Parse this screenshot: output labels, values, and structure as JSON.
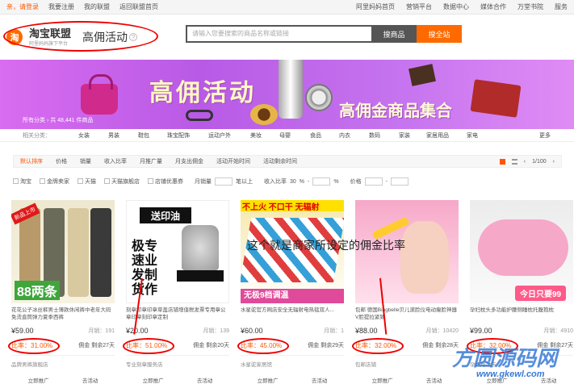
{
  "topnav": {
    "greeting": "亲，请登录",
    "register": "我要注册",
    "my_alliance": "我的联盟",
    "back_home": "返回联盟首页",
    "right_links": [
      "阿里妈妈首页",
      "营销平台",
      "数据中心",
      "媒体合作",
      "万堂书院",
      "服务"
    ]
  },
  "header": {
    "logo_title": "淘宝联盟",
    "logo_sub": "阿里妈妈旗下平台",
    "page_name": "高佣活动",
    "search_placeholder": "请输入您要搜索的商品名称或链接",
    "search_btn_product": "搜商品",
    "search_btn_all": "搜全站"
  },
  "banner": {
    "title": "高佣活动",
    "subtitle": "高佣金商品集合",
    "breadcrumb": "所有分类 › 共 48,441 件商品"
  },
  "categories": {
    "label": "相关分类：",
    "items": [
      "女装",
      "男装",
      "鞋包",
      "珠宝配饰",
      "运动户外",
      "美妆",
      "母婴",
      "食品",
      "内衣",
      "数码",
      "家装",
      "家居用品",
      "家电"
    ],
    "more": "更多"
  },
  "sortbar": {
    "items": [
      "默认排序",
      "价格",
      "销量",
      "收入比率",
      "月推广量",
      "月支出佣金",
      "活动开始时间",
      "活动剩余时间"
    ],
    "page": "1/100"
  },
  "filters": {
    "items": [
      "淘宝",
      "金牌卖家",
      "天猫",
      "天猫旗舰店",
      "店铺优惠券"
    ],
    "monthly_sales": "月销量",
    "monthly_sales_suffix": "笔以上",
    "income_ratio": "收入比率",
    "income_ratio_value": "30",
    "percent": "%",
    "price": "价格"
  },
  "products": [
    {
      "title": "花花公子冰丝裤男士薄款休闲裤中老年大码免烫直筒弹力夏季西裤",
      "price": "59.00",
      "monthly_sales": "月销：191",
      "rate": "比率：31.00%",
      "commission": "佣金",
      "days": "剩余27天",
      "shop": "品牌男裤旗舰店",
      "promote": "立即推广",
      "detail": "去活动"
    },
    {
      "title": "刻章印章印章草盖店铺增值税发票专用章公章印章刻印章定制",
      "price": "20.00",
      "monthly_sales": "月销：139",
      "rate": "比率：51.00%",
      "commission": "佣金",
      "days": "剩余20天",
      "shop": "专业刻章服务店",
      "promote": "立即推广",
      "detail": "去活动"
    },
    {
      "title": "水星驼官方网店安全无辐射电热毯双人...",
      "price": "60.00",
      "monthly_sales": "月销：1",
      "rate": "比率：45.00%",
      "commission": "佣金",
      "days": "剩余29天",
      "shop": "水星驼家居馆",
      "promote": "立即推广",
      "detail": "去活动"
    },
    {
      "title": "包邮 德国Bingbelle贝儿滚脸仪电动瘦脸神器V脸提拉紧致",
      "price": "88.00",
      "monthly_sales": "月销：10420",
      "rate": "比率：32.00%",
      "commission": "佣金",
      "days": "剩余28天",
      "shop": "包邮店铺",
      "promote": "立即推广",
      "detail": "去活动"
    },
    {
      "title": "孕妇枕头多功能护腰侧睡枕托腹抱枕",
      "price": "99.00",
      "monthly_sales": "月销：4910",
      "rate": "比率：32.00%",
      "commission": "佣金",
      "days": "剩余27天",
      "shop": "孕妇用品店",
      "promote": "立即推广",
      "detail": "去活动"
    }
  ],
  "product_labels": {
    "p1_tag": "新品上市",
    "p1_badge": "88两条",
    "p2_banner": "送印油",
    "p2_cols": "极专速业发制货作",
    "p3_top": "不上火 不口干 无辐射",
    "p3_bottom": "无极9档调温",
    "p5_bubble": "今日只要99"
  },
  "annotation": {
    "overlay": "这个就是商家所设定的佣金比率"
  },
  "watermark": {
    "text": "方圆源码网",
    "url": "www.gkewl.com"
  },
  "colors": {
    "accent": "#ff5500",
    "banner": "#c674ef",
    "circle": "#e00000"
  }
}
